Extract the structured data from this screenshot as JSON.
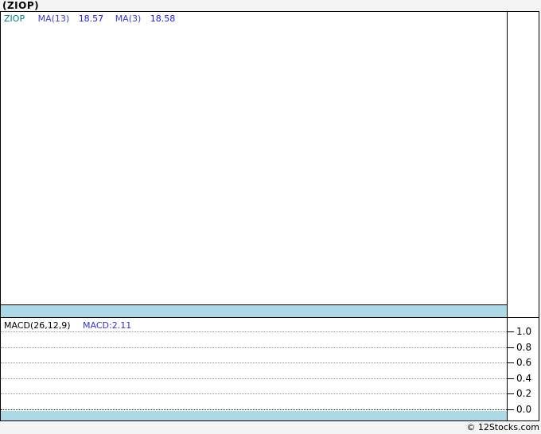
{
  "page": {
    "title": "(ZIOP)",
    "footer_credit": "© 12Stocks.com"
  },
  "main_chart": {
    "legend": {
      "ticker": "ZIOP",
      "ma1_label": "MA(13)",
      "ma1_value": "18.57",
      "ma2_label": "MA(3)",
      "ma2_value": "18.58"
    }
  },
  "macd_chart": {
    "legend_label": "MACD(26,12,9)",
    "legend_value": "MACD:2.11",
    "y_ticks": [
      "1.0",
      "0.8",
      "0.6",
      "0.4",
      "0.2",
      "0.0"
    ]
  },
  "colors": {
    "band_blue": "#add8e6",
    "ticker_teal": "#008080",
    "ma_label_blue": "#3d3dcc",
    "ma_value_blue": "#1a1ae0",
    "macd_value_blue": "#3333cc",
    "grid_gray": "#999999",
    "zero_line_dark": "#1a1a1a",
    "page_background": "#f4f4f4",
    "plot_background": "#ffffff",
    "border_black": "#000000"
  },
  "chart_data": [
    {
      "type": "line",
      "title": "ZIOP price panel",
      "legend_position": "top-left",
      "grid": false,
      "plot_area_empty": true,
      "series": [
        {
          "name": "ZIOP",
          "points": []
        },
        {
          "name": "MA(13)",
          "latest_value": 18.57,
          "points": []
        },
        {
          "name": "MA(3)",
          "latest_value": 18.58,
          "points": []
        }
      ],
      "annotations": [
        "light blue horizontal band at bottom of panel"
      ]
    },
    {
      "type": "line",
      "title": "MACD(26,12,9)",
      "legend_position": "top-left",
      "axis_position": "right",
      "yticks": [
        1.0,
        0.8,
        0.6,
        0.4,
        0.2,
        0.0
      ],
      "ylim": [
        0.0,
        1.0
      ],
      "grid": true,
      "plot_area_empty": true,
      "series": [
        {
          "name": "MACD",
          "latest_value": 2.11,
          "points": []
        }
      ],
      "annotations": [
        "zero line drawn as dark dotted line",
        "light blue horizontal band below zero line"
      ]
    }
  ]
}
